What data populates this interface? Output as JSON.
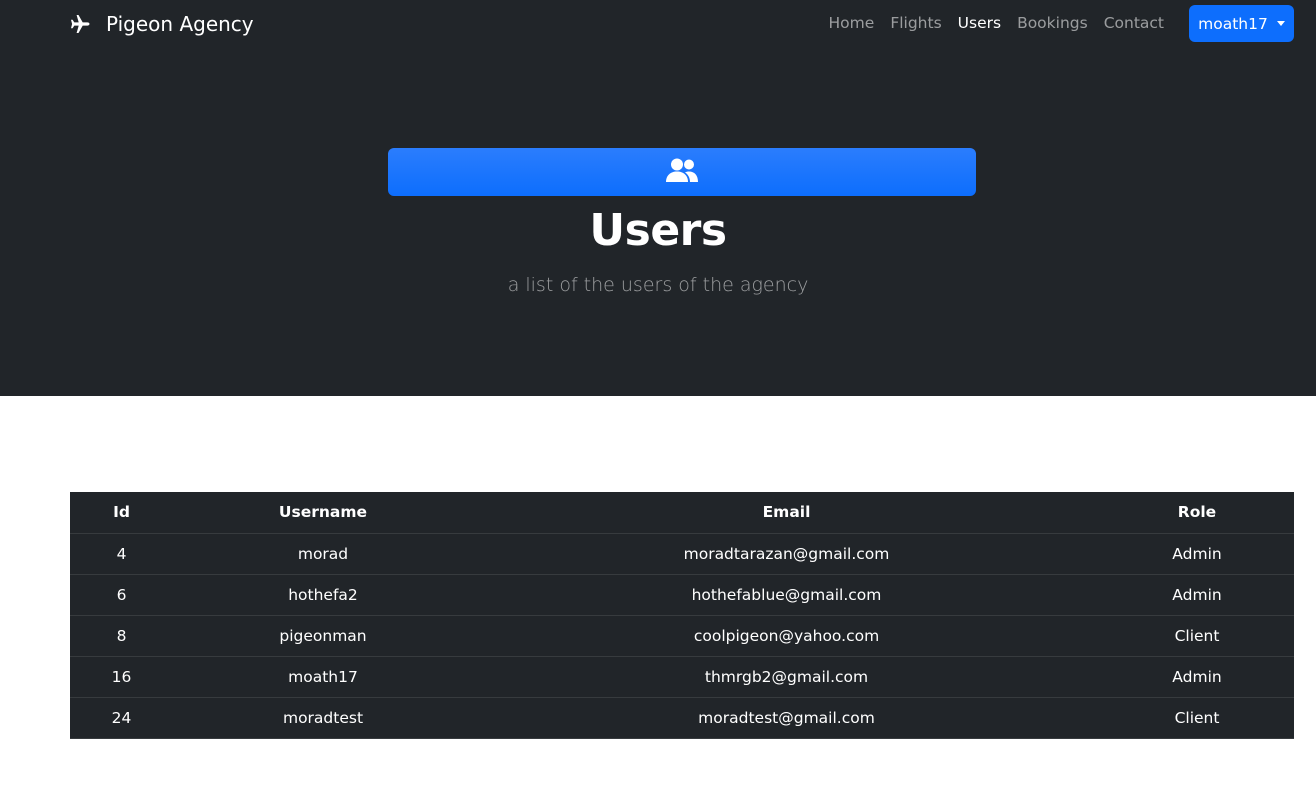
{
  "navbar": {
    "brand": "Pigeon Agency",
    "links": [
      {
        "label": "Home",
        "active": false
      },
      {
        "label": "Flights",
        "active": false
      },
      {
        "label": "Users",
        "active": true
      },
      {
        "label": "Bookings",
        "active": false
      },
      {
        "label": "Contact",
        "active": false
      }
    ],
    "user_menu": "moath17"
  },
  "hero": {
    "icon": "users-icon",
    "title": "Users",
    "subtitle": "a list of the users of the agency"
  },
  "table": {
    "headers": [
      "Id",
      "Username",
      "Email",
      "Role"
    ],
    "rows": [
      [
        "4",
        "morad",
        "moradtarazan@gmail.com",
        "Admin"
      ],
      [
        "6",
        "hothefa2",
        "hothefablue@gmail.com",
        "Admin"
      ],
      [
        "8",
        "pigeonman",
        "coolpigeon@yahoo.com",
        "Client"
      ],
      [
        "16",
        "moath17",
        "thmrgb2@gmail.com",
        "Admin"
      ],
      [
        "24",
        "moradtest",
        "moradtest@gmail.com",
        "Client"
      ]
    ]
  },
  "colors": {
    "dark_bg": "#212529",
    "accent": "#0d6efd",
    "muted_text": "rgba(255,255,255,0.55)"
  }
}
